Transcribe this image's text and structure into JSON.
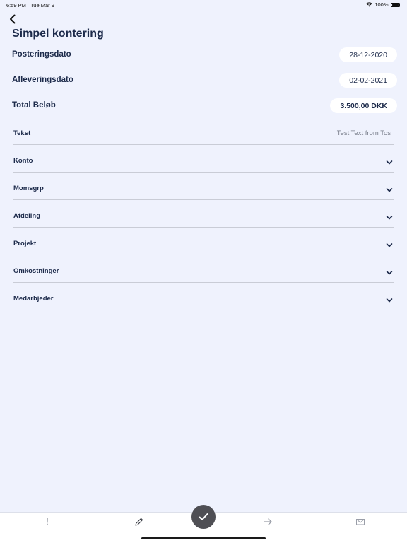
{
  "status_bar": {
    "time": "6:59 PM",
    "date": "Tue Mar 9",
    "battery": "100%"
  },
  "header": {
    "back_icon": "chevron-left-icon",
    "title": "Simpel kontering"
  },
  "summary": {
    "posting_label": "Posteringsdato",
    "posting_value": "28-12-2020",
    "delivery_label": "Afleveringsdato",
    "delivery_value": "02-02-2021",
    "total_label": "Total Beløb",
    "total_value": "3.500,00 DKK"
  },
  "form": {
    "text_label": "Tekst",
    "text_value": "Test Text from Tos",
    "dropdowns": [
      {
        "label": "Konto"
      },
      {
        "label": "Momsgrp"
      },
      {
        "label": "Afdeling"
      },
      {
        "label": "Projekt"
      },
      {
        "label": "Omkostninger"
      },
      {
        "label": "Medarbjeder"
      }
    ]
  },
  "toolbar": {
    "exclamation": "!",
    "icons": [
      "exclamation-icon",
      "pencil-icon",
      "checkmark-icon",
      "arrow-right-icon",
      "envelope-icon"
    ]
  },
  "colors": {
    "background": "#eff2fd",
    "text": "#1c2a4a",
    "confirm": "#4f4f54"
  }
}
